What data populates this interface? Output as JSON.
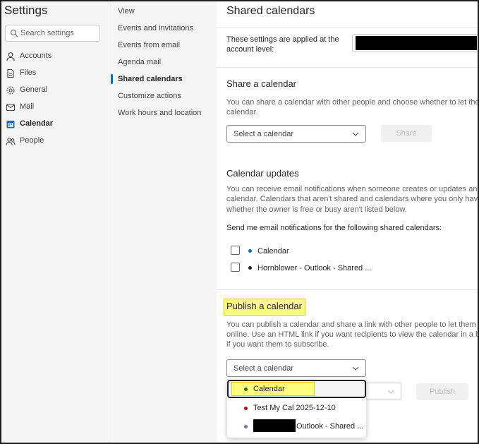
{
  "settings": {
    "title": "Settings",
    "search_placeholder": "Search settings"
  },
  "nav": {
    "items": [
      {
        "label": "Accounts",
        "icon": "person-icon"
      },
      {
        "label": "Files",
        "icon": "file-icon"
      },
      {
        "label": "General",
        "icon": "gear-icon"
      },
      {
        "label": "Mail",
        "icon": "mail-icon"
      },
      {
        "label": "Calendar",
        "icon": "calendar-icon",
        "active": true
      },
      {
        "label": "People",
        "icon": "people-icon"
      }
    ]
  },
  "subnav": {
    "items": [
      {
        "label": "View"
      },
      {
        "label": "Events and invitations"
      },
      {
        "label": "Events from email"
      },
      {
        "label": "Agenda mail"
      },
      {
        "label": "Shared calendars",
        "active": true
      },
      {
        "label": "Customize actions"
      },
      {
        "label": "Work hours and location"
      }
    ]
  },
  "main": {
    "title": "Shared calendars",
    "account_note_line1": "These settings are applied at the",
    "account_note_line2": "account level:",
    "share": {
      "title": "Share a calendar",
      "desc_line1": "You can share a calendar with other people and choose whether to let them v",
      "desc_line2": "calendar.",
      "select_placeholder": "Select a calendar",
      "button": "Share"
    },
    "updates": {
      "title": "Calendar updates",
      "desc_line1": "You can receive email notifications when someone creates or updates an ever",
      "desc_line2": "calendar. Calendars that aren't shared and calendars where you only have per",
      "desc_line3": "whether the owner is free or busy aren't listed below.",
      "send_label": "Send me email notifications for the following shared calendars:",
      "calendars": [
        {
          "name": "Calendar",
          "color": "#0f6cbd"
        },
        {
          "name": "Hornblower - Outlook - Shared ...",
          "color": "#242424"
        }
      ]
    },
    "publish": {
      "title": "Publish a calendar",
      "desc_line1": "You can publish a calendar and share a link with other people to let them view",
      "desc_line2": "online. Use an HTML link if you want recipients to view the calendar in a brow",
      "desc_line3": "if you want them to subscribe.",
      "select_placeholder": "Select a calendar",
      "button": "Publish",
      "dropdown_options": [
        {
          "name": "Calendar",
          "color": "#107c10",
          "selected": true
        },
        {
          "name": "Test My Cal 2025-12-10",
          "color": "#c50f1f"
        },
        {
          "name": "Outlook - Shared ...",
          "color": "#8764b8"
        }
      ]
    }
  },
  "colors": {
    "accent": "#0f6cbd",
    "highlight": "#fffb7d"
  }
}
